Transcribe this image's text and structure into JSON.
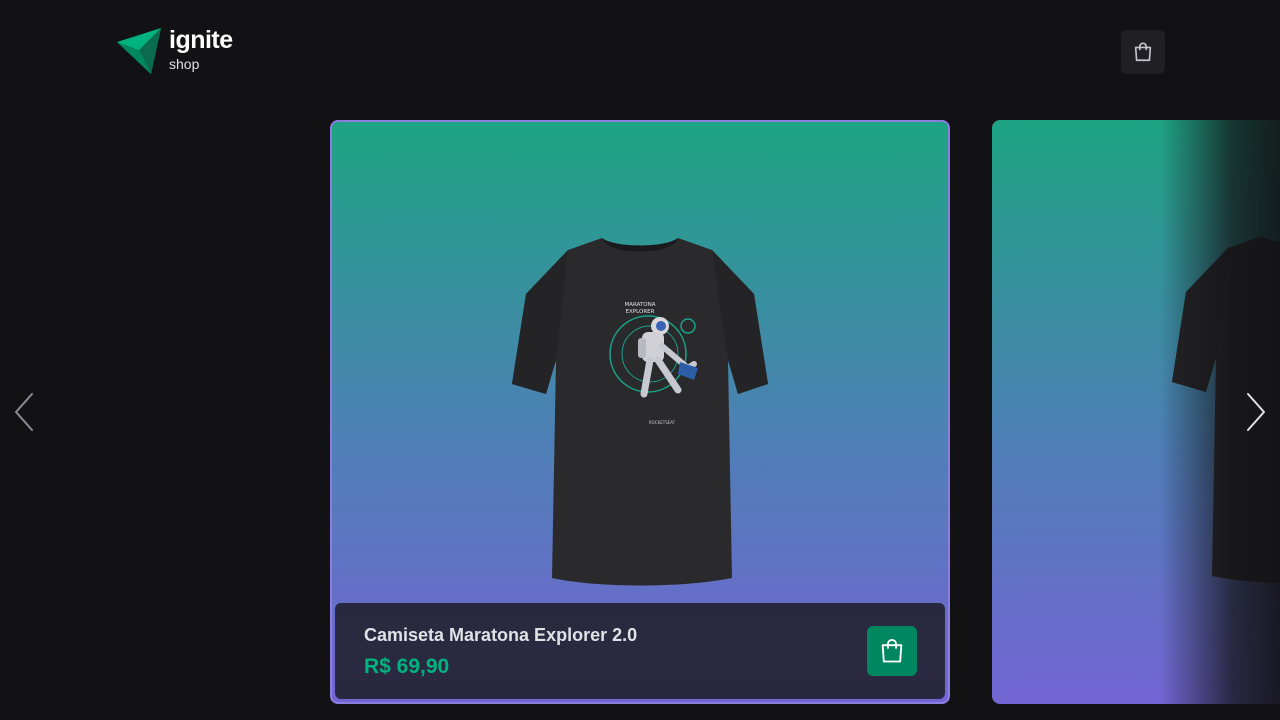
{
  "header": {
    "logo_title": "ignite",
    "logo_subtitle": "shop",
    "cart_icon": "shopping-bag-icon"
  },
  "carousel": {
    "prev_icon": "chevron-left-icon",
    "next_icon": "chevron-right-icon",
    "products": [
      {
        "name": "Camiseta Maratona Explorer 2.0",
        "price": "R$ 69,90",
        "add_icon": "shopping-bag-icon"
      }
    ]
  },
  "colors": {
    "background": "#121214",
    "accent_green": "#00875f",
    "price_green": "#00b37e",
    "gradient_top": "#1ea483",
    "gradient_bottom": "#7465d4"
  }
}
